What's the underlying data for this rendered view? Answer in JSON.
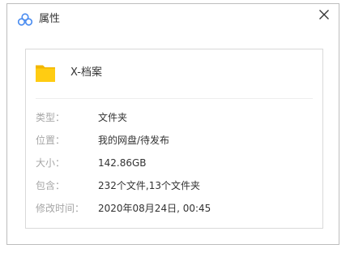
{
  "window": {
    "title": "属性",
    "close_glyph": "✕"
  },
  "file": {
    "name": "X-档案",
    "icon": "folder-icon",
    "icon_color": "#f7c600"
  },
  "properties": [
    {
      "label": "类型：",
      "value": "文件夹"
    },
    {
      "label": "位置：",
      "value": "我的网盘/待发布"
    },
    {
      "label": "大小：",
      "value": "142.86GB"
    },
    {
      "label": "包含：",
      "value": "232个文件,13个文件夹"
    },
    {
      "label": "修改时间：",
      "value": "2020年08月24日, 00:45"
    }
  ],
  "colors": {
    "label": "#a6a6a6",
    "value": "#333333",
    "logo": "#4a8cf0"
  }
}
